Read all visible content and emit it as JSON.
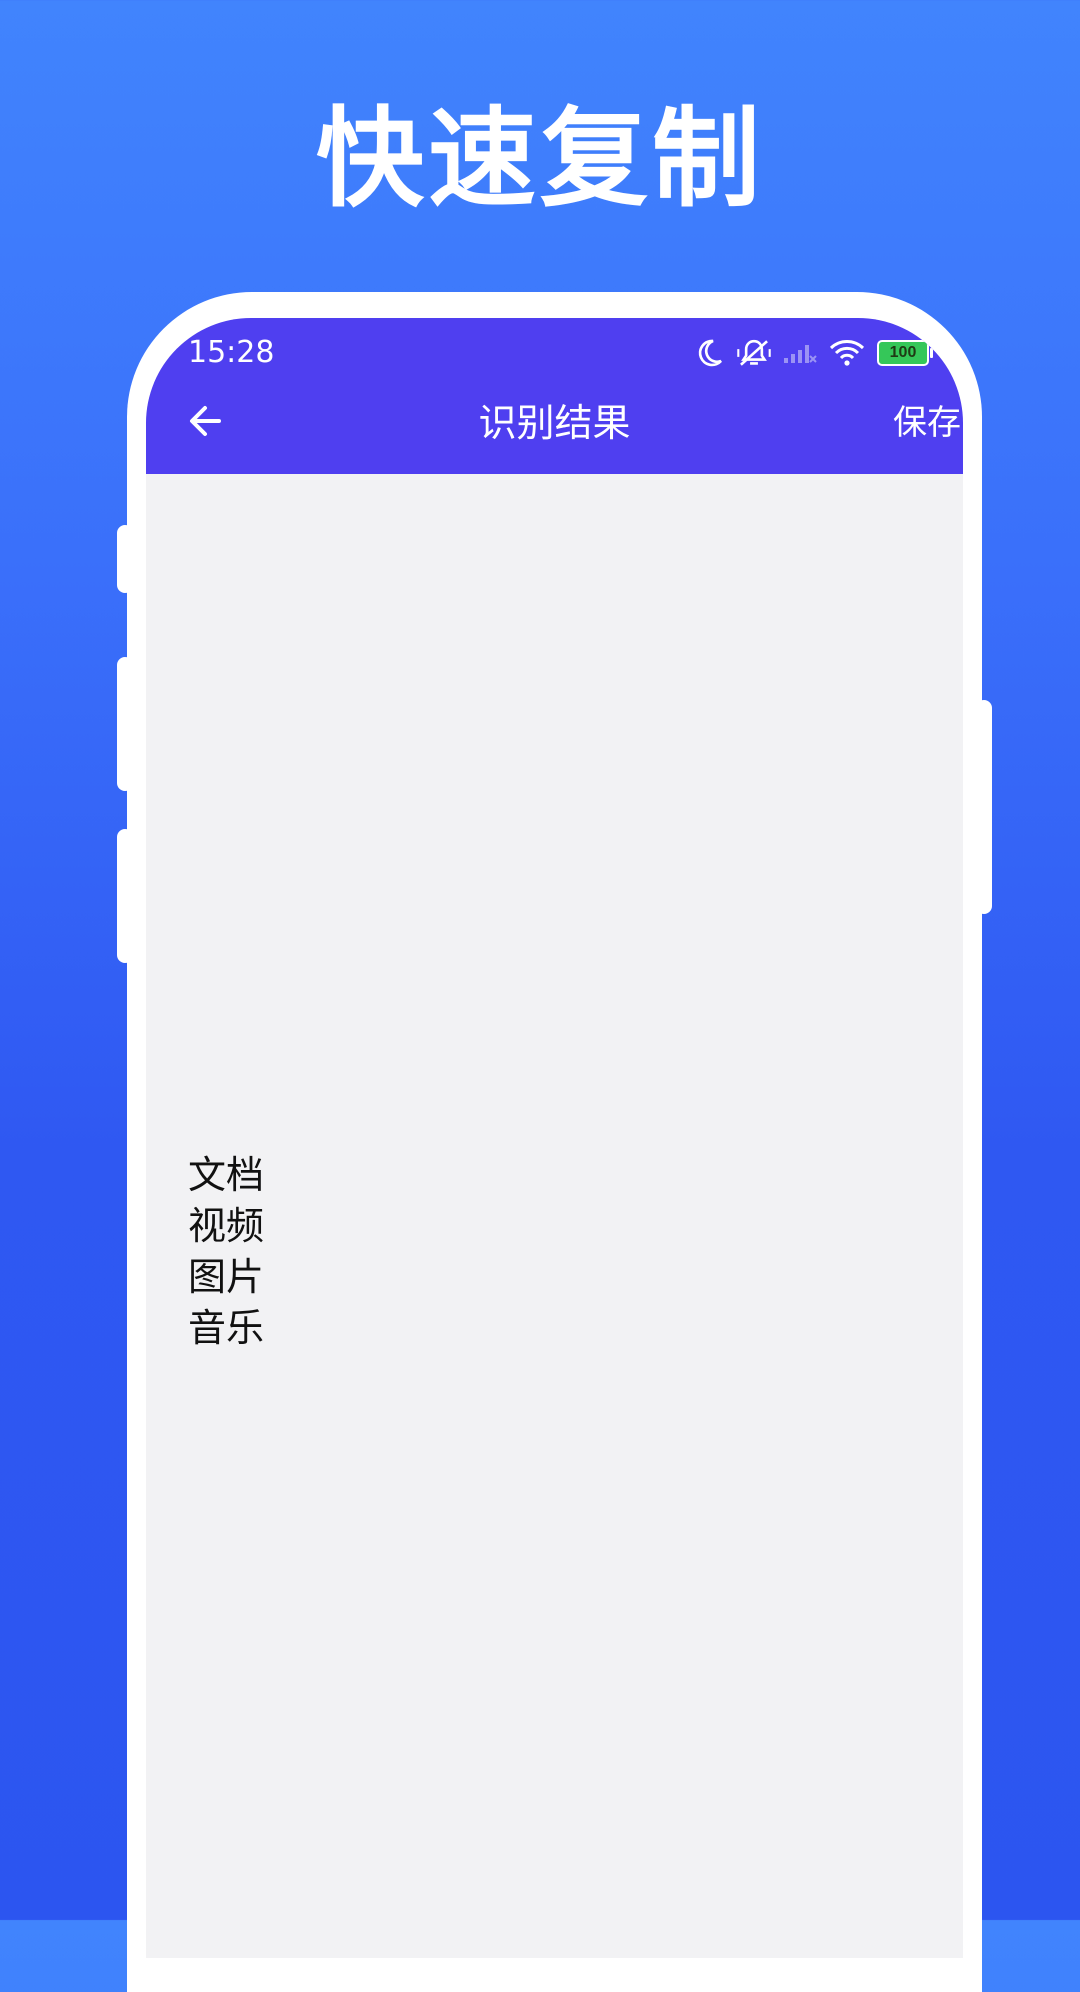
{
  "headline": "快速复制",
  "status_bar": {
    "time": "15:28",
    "battery": "100",
    "icons": [
      "moon-icon",
      "vibrate-off-icon",
      "cellular-signal-icon",
      "wifi-icon",
      "battery-icon",
      "charging-icon"
    ]
  },
  "app_bar": {
    "title": "识别结果",
    "save_label": "保存",
    "back_icon": "arrow-left-icon"
  },
  "result_lines": [
    "文档",
    "视频",
    "图片",
    "音乐"
  ],
  "colors": {
    "background_top": "#4184fd",
    "background_bottom": "#2c55f0",
    "app_bar": "#4f3ff0",
    "content_background": "#f2f2f4",
    "battery_fill": "#35c759"
  }
}
